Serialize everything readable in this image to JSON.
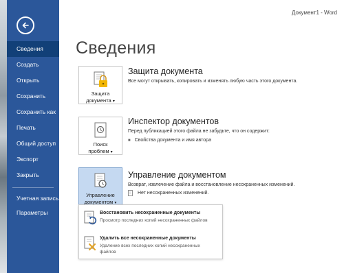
{
  "window": {
    "title": "Документ1 - Word"
  },
  "sidebar": {
    "items": [
      {
        "label": "Сведения",
        "active": true
      },
      {
        "label": "Создать"
      },
      {
        "label": "Открыть"
      },
      {
        "label": "Сохранить"
      },
      {
        "label": "Сохранить как"
      },
      {
        "label": "Печать"
      },
      {
        "label": "Общий доступ"
      },
      {
        "label": "Экспорт"
      },
      {
        "label": "Закрыть"
      },
      {
        "label": "Учетная запись"
      },
      {
        "label": "Параметры"
      }
    ]
  },
  "page": {
    "title": "Сведения"
  },
  "protect": {
    "button_line1": "Защита",
    "button_line2": "документа",
    "heading": "Защита документа",
    "description": "Все могут открывать, копировать и изменять любую часть этого документа."
  },
  "inspect": {
    "button_line1": "Поиск",
    "button_line2": "проблем",
    "heading": "Инспектор документов",
    "description": "Перед публикацией этого файла не забудьте, что он содержит:",
    "bullet": "Свойства документа и имя автора"
  },
  "manage": {
    "button_line1": "Управление",
    "button_line2": "документом",
    "heading": "Управление документом",
    "description": "Возврат, извлечение файла и восстановление несохраненных изменений.",
    "status": "Нет несохраненных изменений."
  },
  "dropdown": {
    "items": [
      {
        "title": "Восстановить несохраненные документы",
        "desc": "Просмотр последних копий несохраненных файлов"
      },
      {
        "title": "Удалить все несохраненные документы",
        "desc": "Удаление всех последних копий несохраненных файлов"
      }
    ]
  },
  "colors": {
    "sidebar": "#2b579a",
    "active": "#124078",
    "highlight": "#c5d9f1"
  }
}
